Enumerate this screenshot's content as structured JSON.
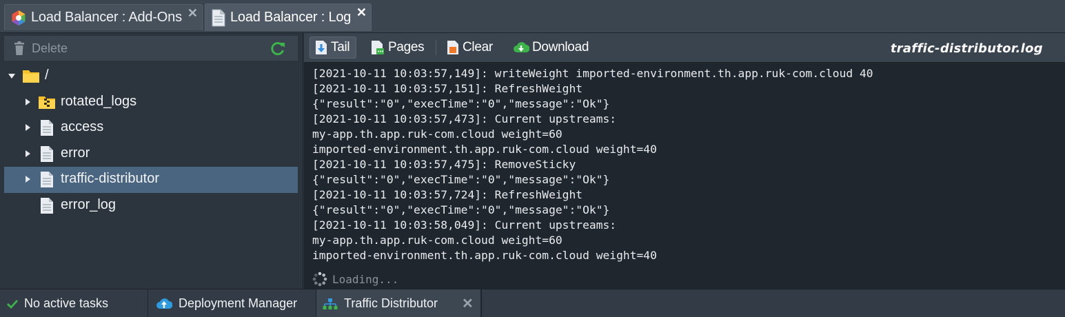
{
  "tabs": [
    {
      "label": "Load Balancer : Add-Ons",
      "icon": "addons-icon",
      "active": false
    },
    {
      "label": "Load Balancer : Log",
      "icon": "log-file-icon",
      "active": true
    }
  ],
  "left_toolbar": {
    "delete_label": "Delete",
    "refresh_icon": "refresh-icon"
  },
  "tree": {
    "root": "/",
    "items": [
      {
        "label": "rotated_logs",
        "icon": "archive-folder-icon"
      },
      {
        "label": "access",
        "icon": "file-icon"
      },
      {
        "label": "error",
        "icon": "file-icon"
      },
      {
        "label": "traffic-distributor",
        "icon": "file-icon",
        "selected": true
      },
      {
        "label": "error_log",
        "icon": "file-icon"
      }
    ]
  },
  "log_toolbar": {
    "tail_label": "Tail",
    "pages_label": "Pages",
    "clear_label": "Clear",
    "download_label": "Download",
    "file_name": "traffic-distributor.log"
  },
  "log_lines": [
    "[2021-10-11 10:03:57,149]: writeWeight imported-environment.th.app.ruk-com.cloud 40",
    "[2021-10-11 10:03:57,151]: RefreshWeight",
    "{\"result\":\"0\",\"execTime\":\"0\",\"message\":\"Ok\"}",
    "[2021-10-11 10:03:57,473]: Current upstreams:",
    "my-app.th.app.ruk-com.cloud weight=60",
    "imported-environment.th.app.ruk-com.cloud weight=40",
    "[2021-10-11 10:03:57,475]: RemoveSticky",
    "{\"result\":\"0\",\"execTime\":\"0\",\"message\":\"Ok\"}",
    "[2021-10-11 10:03:57,724]: RefreshWeight",
    "{\"result\":\"0\",\"execTime\":\"0\",\"message\":\"Ok\"}",
    "[2021-10-11 10:03:58,049]: Current upstreams:",
    "my-app.th.app.ruk-com.cloud weight=60",
    "imported-environment.th.app.ruk-com.cloud weight=40"
  ],
  "loading_text": "Loading...",
  "statusbar": {
    "tasks_label": "No active tasks",
    "deployment_label": "Deployment Manager",
    "traffic_label": "Traffic Distributor"
  },
  "colors": {
    "selected_row": "#4a6580",
    "accent_green": "#3cb44a",
    "folder_yellow": "#f5c02a",
    "cloud_blue": "#2e9ae0"
  }
}
